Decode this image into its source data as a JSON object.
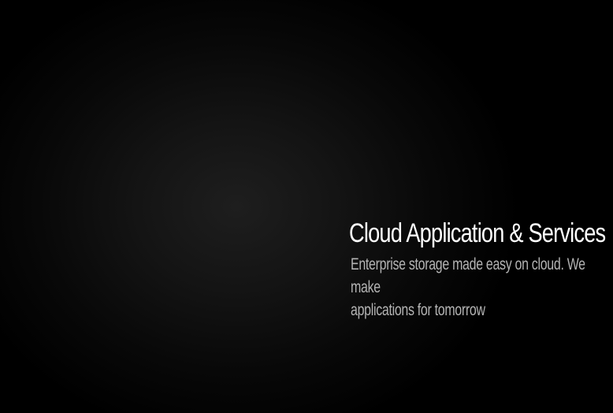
{
  "hero": {
    "title": "Cloud Application & Services",
    "subtitle_line1": "Enterprise storage made easy on cloud. We make",
    "subtitle_line2": "applications for tomorrow"
  }
}
